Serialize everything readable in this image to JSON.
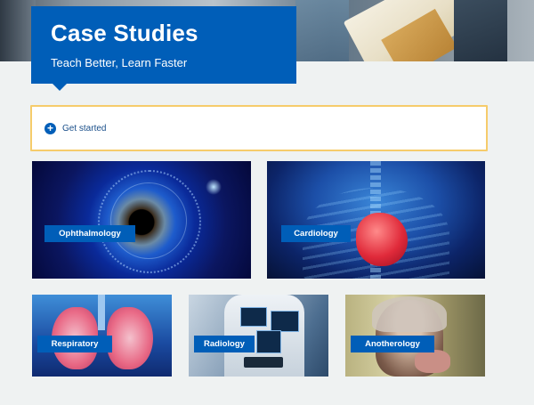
{
  "header": {
    "title": "Case Studies",
    "subtitle": "Teach Better, Learn Faster"
  },
  "get_started": {
    "icon": "plus-circle-icon",
    "label": "Get started",
    "border_color": "#f6cc6b"
  },
  "colors": {
    "brand": "#005eb8",
    "background": "#eff2f2"
  },
  "categories": [
    {
      "label": "Ophthalmology",
      "image": "eye-image"
    },
    {
      "label": "Cardiology",
      "image": "heart-image"
    },
    {
      "label": "Respiratory",
      "image": "lungs-image"
    },
    {
      "label": "Radiology",
      "image": "radiology-image"
    },
    {
      "label": "Anotherology",
      "image": "elderly-woman-image"
    }
  ]
}
